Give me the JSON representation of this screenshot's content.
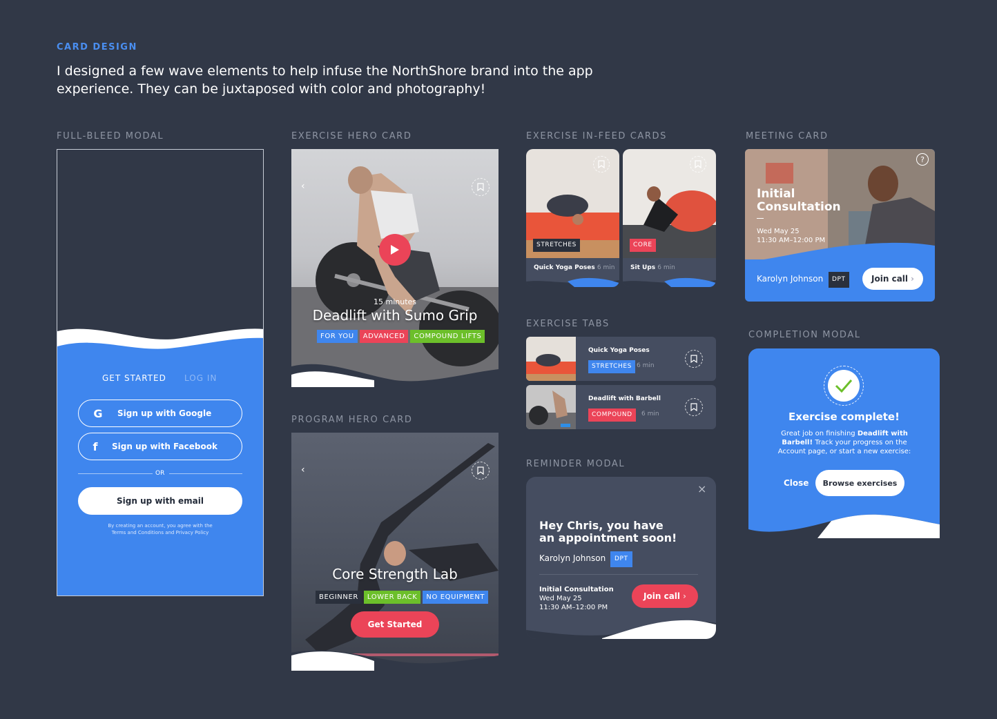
{
  "header": {
    "eyebrow": "CARD DESIGN",
    "intro": "I designed a few wave elements to help infuse the NorthShore brand into the app experience. They can be juxtaposed with color and photography!"
  },
  "sections": {
    "full_bleed": "FULL-BLEED MODAL",
    "exercise_hero": "EXERCISE HERO CARD",
    "program_hero": "PROGRAM HERO CARD",
    "in_feed": "EXERCISE IN-FEED CARDS",
    "tabs": "EXERCISE TABS",
    "reminder": "REMINDER MODAL",
    "meeting": "MEETING CARD",
    "completion": "COMPLETION MODAL"
  },
  "full_bleed": {
    "tab_active": "GET STARTED",
    "tab_inactive": "LOG IN",
    "google": "Sign up with Google",
    "facebook": "Sign up with Facebook",
    "or": "OR",
    "email": "Sign up with email",
    "legal_1": "By creating an account, you agree with the",
    "legal_2": "Terms and Conditions and Privacy Policy"
  },
  "exercise_hero": {
    "duration": "15 minutes",
    "title": "Deadlift with Sumo Grip",
    "tags": [
      "FOR YOU",
      "ADVANCED",
      "COMPOUND LIFTS"
    ]
  },
  "program_hero": {
    "title": "Core Strength Lab",
    "tags": [
      "BEGINNER",
      "LOWER BACK",
      "NO EQUIPMENT"
    ],
    "cta": "Get Started"
  },
  "in_feed": [
    {
      "tag": "STRETCHES",
      "title": "Quick Yoga Poses",
      "duration": "6 min"
    },
    {
      "tag": "CORE",
      "title": "Sit Ups",
      "duration": "6 min"
    }
  ],
  "tabs": [
    {
      "title": "Quick Yoga Poses",
      "tag": "STRETCHES",
      "duration": "6 min"
    },
    {
      "title": "Deadlift with Barbell",
      "tag": "COMPOUND",
      "duration": "6 min"
    }
  ],
  "reminder": {
    "heading_1": "Hey Chris, you have",
    "heading_2": "an appointment soon!",
    "provider": "Karolyn Johnson",
    "badge": "DPT",
    "appt_title": "Initial Consultation",
    "appt_date": "Wed May 25",
    "appt_time": "11:30 AM–12:00 PM",
    "cta": "Join call"
  },
  "meeting": {
    "title_1": "Initial",
    "title_2": "Consultation",
    "date": "Wed May 25",
    "time": "11:30 AM–12:00 PM",
    "provider": "Karolyn Johnson",
    "badge": "DPT",
    "cta": "Join call"
  },
  "completion": {
    "title": "Exercise complete!",
    "body_1": "Great job on finishing ",
    "body_bold": "Deadlift with Barbell!",
    "body_2": " Track your progress on the Account page, or start a new exercise:",
    "close": "Close",
    "browse": "Browse exercises"
  },
  "colors": {
    "background": "#313847",
    "brand_blue": "#3f86ee",
    "accent_red": "#eb4458",
    "accent_green": "#6cbf2a"
  }
}
